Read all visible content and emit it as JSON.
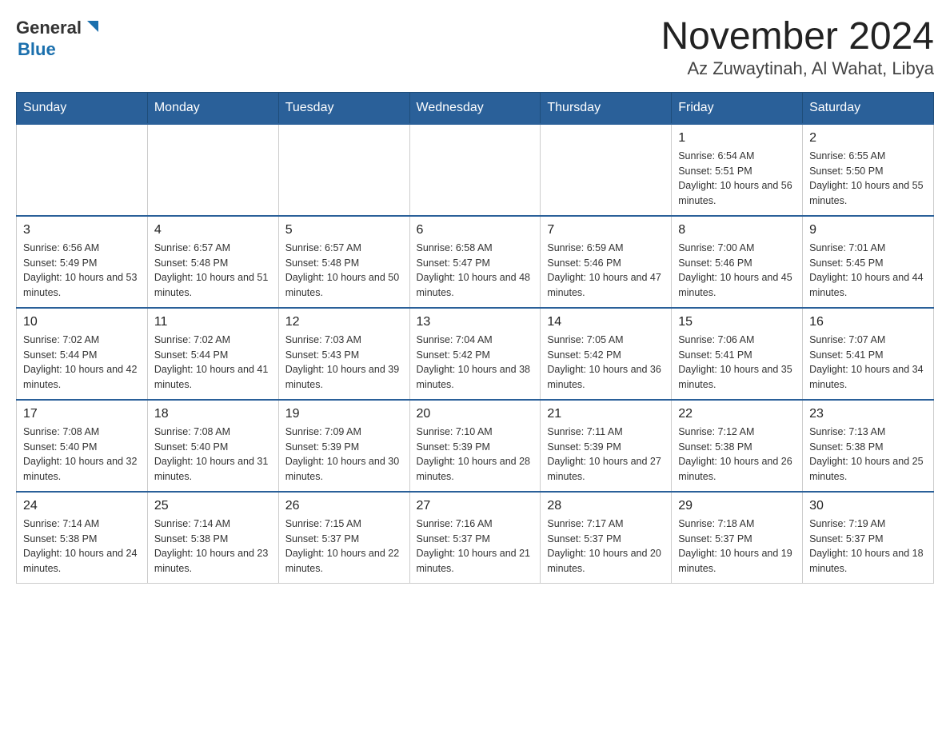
{
  "logo": {
    "general": "General",
    "blue": "Blue"
  },
  "title": {
    "month_year": "November 2024",
    "location": "Az Zuwaytinah, Al Wahat, Libya"
  },
  "weekdays": [
    "Sunday",
    "Monday",
    "Tuesday",
    "Wednesday",
    "Thursday",
    "Friday",
    "Saturday"
  ],
  "weeks": [
    [
      {
        "day": "",
        "sunrise": "",
        "sunset": "",
        "daylight": ""
      },
      {
        "day": "",
        "sunrise": "",
        "sunset": "",
        "daylight": ""
      },
      {
        "day": "",
        "sunrise": "",
        "sunset": "",
        "daylight": ""
      },
      {
        "day": "",
        "sunrise": "",
        "sunset": "",
        "daylight": ""
      },
      {
        "day": "",
        "sunrise": "",
        "sunset": "",
        "daylight": ""
      },
      {
        "day": "1",
        "sunrise": "Sunrise: 6:54 AM",
        "sunset": "Sunset: 5:51 PM",
        "daylight": "Daylight: 10 hours and 56 minutes."
      },
      {
        "day": "2",
        "sunrise": "Sunrise: 6:55 AM",
        "sunset": "Sunset: 5:50 PM",
        "daylight": "Daylight: 10 hours and 55 minutes."
      }
    ],
    [
      {
        "day": "3",
        "sunrise": "Sunrise: 6:56 AM",
        "sunset": "Sunset: 5:49 PM",
        "daylight": "Daylight: 10 hours and 53 minutes."
      },
      {
        "day": "4",
        "sunrise": "Sunrise: 6:57 AM",
        "sunset": "Sunset: 5:48 PM",
        "daylight": "Daylight: 10 hours and 51 minutes."
      },
      {
        "day": "5",
        "sunrise": "Sunrise: 6:57 AM",
        "sunset": "Sunset: 5:48 PM",
        "daylight": "Daylight: 10 hours and 50 minutes."
      },
      {
        "day": "6",
        "sunrise": "Sunrise: 6:58 AM",
        "sunset": "Sunset: 5:47 PM",
        "daylight": "Daylight: 10 hours and 48 minutes."
      },
      {
        "day": "7",
        "sunrise": "Sunrise: 6:59 AM",
        "sunset": "Sunset: 5:46 PM",
        "daylight": "Daylight: 10 hours and 47 minutes."
      },
      {
        "day": "8",
        "sunrise": "Sunrise: 7:00 AM",
        "sunset": "Sunset: 5:46 PM",
        "daylight": "Daylight: 10 hours and 45 minutes."
      },
      {
        "day": "9",
        "sunrise": "Sunrise: 7:01 AM",
        "sunset": "Sunset: 5:45 PM",
        "daylight": "Daylight: 10 hours and 44 minutes."
      }
    ],
    [
      {
        "day": "10",
        "sunrise": "Sunrise: 7:02 AM",
        "sunset": "Sunset: 5:44 PM",
        "daylight": "Daylight: 10 hours and 42 minutes."
      },
      {
        "day": "11",
        "sunrise": "Sunrise: 7:02 AM",
        "sunset": "Sunset: 5:44 PM",
        "daylight": "Daylight: 10 hours and 41 minutes."
      },
      {
        "day": "12",
        "sunrise": "Sunrise: 7:03 AM",
        "sunset": "Sunset: 5:43 PM",
        "daylight": "Daylight: 10 hours and 39 minutes."
      },
      {
        "day": "13",
        "sunrise": "Sunrise: 7:04 AM",
        "sunset": "Sunset: 5:42 PM",
        "daylight": "Daylight: 10 hours and 38 minutes."
      },
      {
        "day": "14",
        "sunrise": "Sunrise: 7:05 AM",
        "sunset": "Sunset: 5:42 PM",
        "daylight": "Daylight: 10 hours and 36 minutes."
      },
      {
        "day": "15",
        "sunrise": "Sunrise: 7:06 AM",
        "sunset": "Sunset: 5:41 PM",
        "daylight": "Daylight: 10 hours and 35 minutes."
      },
      {
        "day": "16",
        "sunrise": "Sunrise: 7:07 AM",
        "sunset": "Sunset: 5:41 PM",
        "daylight": "Daylight: 10 hours and 34 minutes."
      }
    ],
    [
      {
        "day": "17",
        "sunrise": "Sunrise: 7:08 AM",
        "sunset": "Sunset: 5:40 PM",
        "daylight": "Daylight: 10 hours and 32 minutes."
      },
      {
        "day": "18",
        "sunrise": "Sunrise: 7:08 AM",
        "sunset": "Sunset: 5:40 PM",
        "daylight": "Daylight: 10 hours and 31 minutes."
      },
      {
        "day": "19",
        "sunrise": "Sunrise: 7:09 AM",
        "sunset": "Sunset: 5:39 PM",
        "daylight": "Daylight: 10 hours and 30 minutes."
      },
      {
        "day": "20",
        "sunrise": "Sunrise: 7:10 AM",
        "sunset": "Sunset: 5:39 PM",
        "daylight": "Daylight: 10 hours and 28 minutes."
      },
      {
        "day": "21",
        "sunrise": "Sunrise: 7:11 AM",
        "sunset": "Sunset: 5:39 PM",
        "daylight": "Daylight: 10 hours and 27 minutes."
      },
      {
        "day": "22",
        "sunrise": "Sunrise: 7:12 AM",
        "sunset": "Sunset: 5:38 PM",
        "daylight": "Daylight: 10 hours and 26 minutes."
      },
      {
        "day": "23",
        "sunrise": "Sunrise: 7:13 AM",
        "sunset": "Sunset: 5:38 PM",
        "daylight": "Daylight: 10 hours and 25 minutes."
      }
    ],
    [
      {
        "day": "24",
        "sunrise": "Sunrise: 7:14 AM",
        "sunset": "Sunset: 5:38 PM",
        "daylight": "Daylight: 10 hours and 24 minutes."
      },
      {
        "day": "25",
        "sunrise": "Sunrise: 7:14 AM",
        "sunset": "Sunset: 5:38 PM",
        "daylight": "Daylight: 10 hours and 23 minutes."
      },
      {
        "day": "26",
        "sunrise": "Sunrise: 7:15 AM",
        "sunset": "Sunset: 5:37 PM",
        "daylight": "Daylight: 10 hours and 22 minutes."
      },
      {
        "day": "27",
        "sunrise": "Sunrise: 7:16 AM",
        "sunset": "Sunset: 5:37 PM",
        "daylight": "Daylight: 10 hours and 21 minutes."
      },
      {
        "day": "28",
        "sunrise": "Sunrise: 7:17 AM",
        "sunset": "Sunset: 5:37 PM",
        "daylight": "Daylight: 10 hours and 20 minutes."
      },
      {
        "day": "29",
        "sunrise": "Sunrise: 7:18 AM",
        "sunset": "Sunset: 5:37 PM",
        "daylight": "Daylight: 10 hours and 19 minutes."
      },
      {
        "day": "30",
        "sunrise": "Sunrise: 7:19 AM",
        "sunset": "Sunset: 5:37 PM",
        "daylight": "Daylight: 10 hours and 18 minutes."
      }
    ]
  ]
}
